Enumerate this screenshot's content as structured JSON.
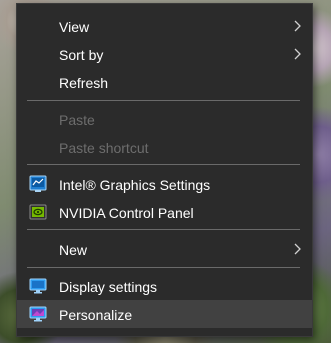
{
  "menu": {
    "items": [
      {
        "label": "View",
        "submenu": true
      },
      {
        "label": "Sort by",
        "submenu": true
      },
      {
        "label": "Refresh"
      },
      {
        "label": "Paste",
        "disabled": true
      },
      {
        "label": "Paste shortcut",
        "disabled": true
      },
      {
        "label": "Intel® Graphics Settings",
        "icon": "intel-graphics-icon"
      },
      {
        "label": "NVIDIA Control Panel",
        "icon": "nvidia-icon"
      },
      {
        "label": "New",
        "submenu": true
      },
      {
        "label": "Display settings",
        "icon": "display-settings-icon"
      },
      {
        "label": "Personalize",
        "icon": "personalize-icon",
        "highlighted": true
      }
    ]
  },
  "colors": {
    "menu_background": "#2b2b2b",
    "highlight": "#414141",
    "text": "#ffffff",
    "disabled_text": "#6d6d6d",
    "separator": "#6a6a6a"
  }
}
